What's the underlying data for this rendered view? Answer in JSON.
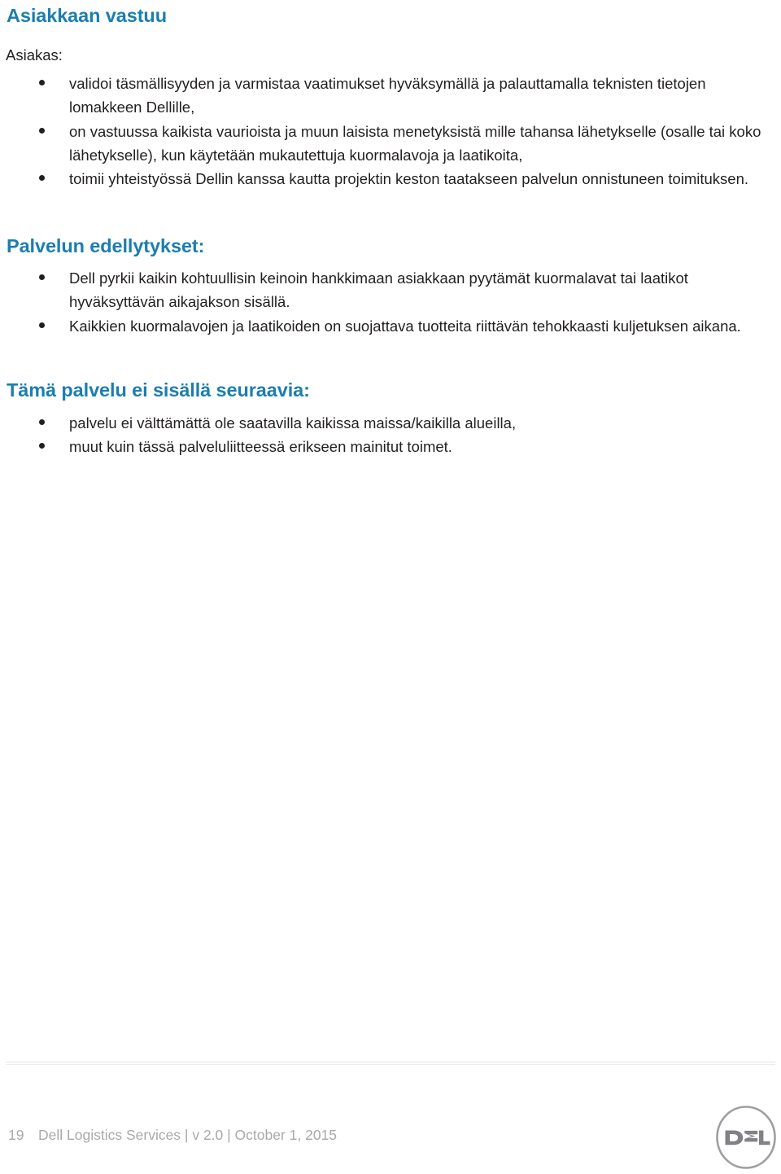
{
  "document": {
    "language": "fi",
    "page_number": "19",
    "accent_color": "#1b7eb0",
    "body_color": "#231f20",
    "footer_color": "#a7a9ac"
  },
  "sections": [
    {
      "heading": "Asiakkaan vastuu",
      "intro_label": "Asiakas:",
      "bullets": [
        "validoi täsmällisyyden ja varmistaa vaatimukset hyväksymällä ja palauttamalla teknisten tietojen lomakkeen Dellille,",
        "on vastuussa kaikista vaurioista ja muun laisista menetyksistä mille tahansa lähetykselle (osalle tai koko lähetykselle), kun käytetään mukautettuja kuormalavoja ja laatikoita,",
        "toimii yhteistyössä Dellin kanssa kautta projektin keston taatakseen palvelun onnistuneen toimituksen."
      ]
    },
    {
      "heading": "Palvelun edellytykset:",
      "bullets": [
        "Dell pyrkii kaikin kohtuullisin keinoin hankkimaan asiakkaan pyytämät kuormalavat tai laatikot hyväksyttävän aikajakson sisällä.",
        "Kaikkien kuormalavojen ja laatikoiden on suojattava tuotteita riittävän tehokkaasti kuljetuksen aikana."
      ]
    },
    {
      "heading": "Tämä palvelu ei sisällä seuraavia:",
      "bullets": [
        "palvelu ei välttämättä ole saatavilla kaikissa maissa/kaikilla alueilla,",
        "muut kuin tässä palveluliitteessä erikseen mainitut toimet."
      ]
    }
  ],
  "footer": {
    "page_number": "19",
    "caption": "Dell Logistics Services | v 2.0 | October 1, 2015",
    "logo": {
      "name": "dell-logo",
      "wordmark": "DELL"
    }
  }
}
